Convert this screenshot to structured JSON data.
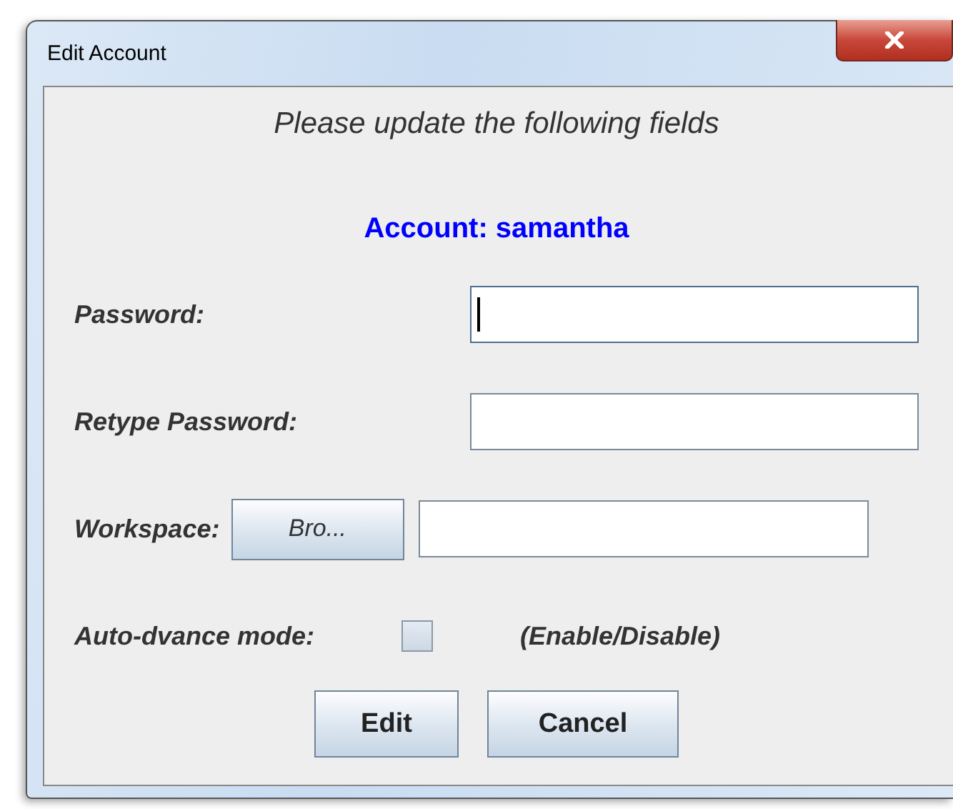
{
  "window": {
    "title": "Edit Account"
  },
  "subtitle": "Please update the following fields",
  "account": "Account: samantha",
  "rows": [
    {
      "kind": "field",
      "label": "Password:",
      "focused": true
    },
    {
      "kind": "field",
      "label": "Retype Password:",
      "focused": false
    },
    {
      "kind": "browse",
      "label": "Workspace:",
      "button": "Bro...",
      "focused": false
    },
    {
      "kind": "checkbox",
      "label": "Auto-dvance mode:",
      "checked": false,
      "note": "(Enable/Disable)"
    }
  ],
  "buttons": [
    "Edit",
    "Cancel"
  ]
}
